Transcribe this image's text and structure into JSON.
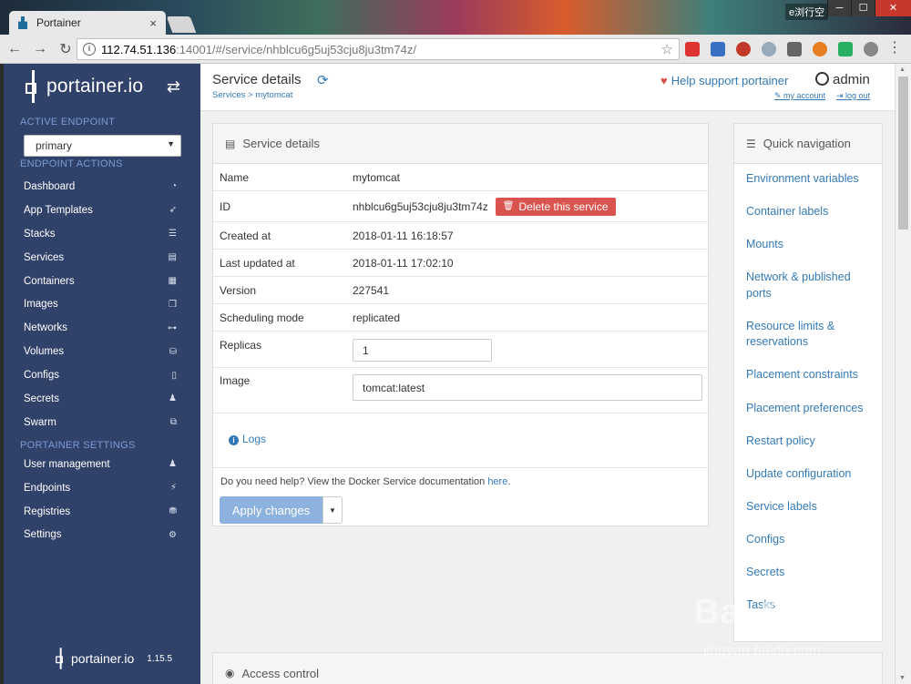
{
  "browser": {
    "tab_title": "Portainer",
    "tab_close": "×",
    "window_badge": "e浏行空",
    "url_host": "112.74.51.136",
    "url_path": ":14001/#/service/nhblcu6g5uj53cju8ju3tm74z/",
    "window_buttons": [
      "─",
      "☐",
      "✕"
    ]
  },
  "sidebar": {
    "logo_text": "portainer.io",
    "active_endpoint_heading": "ACTIVE ENDPOINT",
    "endpoint_value": "primary",
    "endpoint_actions_heading": "ENDPOINT ACTIONS",
    "endpoint_items": [
      {
        "label": "Dashboard",
        "icon": "dashboard-icon",
        "glyph": "◔"
      },
      {
        "label": "App Templates",
        "icon": "rocket-icon",
        "glyph": "➶"
      },
      {
        "label": "Stacks",
        "icon": "list-icon",
        "glyph": "☰"
      },
      {
        "label": "Services",
        "icon": "services-icon",
        "glyph": "▤"
      },
      {
        "label": "Containers",
        "icon": "containers-icon",
        "glyph": "▦"
      },
      {
        "label": "Images",
        "icon": "images-icon",
        "glyph": "❐"
      },
      {
        "label": "Networks",
        "icon": "sitemap-icon",
        "glyph": "⊶"
      },
      {
        "label": "Volumes",
        "icon": "cubes-icon",
        "glyph": "⛁"
      },
      {
        "label": "Configs",
        "icon": "file-code-icon",
        "glyph": "▯"
      },
      {
        "label": "Secrets",
        "icon": "user-secret-icon",
        "glyph": "♟"
      },
      {
        "label": "Swarm",
        "icon": "object-group-icon",
        "glyph": "⧉"
      }
    ],
    "portainer_settings_heading": "PORTAINER SETTINGS",
    "settings_items": [
      {
        "label": "User management",
        "icon": "users-icon",
        "glyph": "♟"
      },
      {
        "label": "Endpoints",
        "icon": "plug-icon",
        "glyph": "⚡"
      },
      {
        "label": "Registries",
        "icon": "database-icon",
        "glyph": "⛃"
      },
      {
        "label": "Settings",
        "icon": "cogs-icon",
        "glyph": "⚙"
      }
    ],
    "footer_logo": "portainer.io",
    "version": "1.15.5"
  },
  "header": {
    "title": "Service details",
    "breadcrumb": "Services > mytomcat",
    "help_support": "Help support portainer",
    "username": "admin",
    "my_account": "my account",
    "log_out": "log out"
  },
  "details": {
    "panel_title": "Service details",
    "rows": [
      {
        "key": "Name",
        "value": "mytomcat"
      },
      {
        "key": "ID",
        "value": "nhblcu6g5uj53cju8ju3tm74z"
      },
      {
        "key": "Created at",
        "value": "2018-01-11 16:18:57"
      },
      {
        "key": "Last updated at",
        "value": "2018-01-11 17:02:10"
      },
      {
        "key": "Version",
        "value": "227541"
      },
      {
        "key": "Scheduling mode",
        "value": "replicated"
      },
      {
        "key": "Replicas",
        "value": "1"
      },
      {
        "key": "Image",
        "value": "tomcat:latest"
      }
    ],
    "delete_button": "Delete this service",
    "logs_link": "Logs",
    "help_text": "Do you need help? View the Docker Service documentation",
    "help_link": "here",
    "help_tail": ".",
    "apply_button": "Apply changes"
  },
  "quick_nav": {
    "title": "Quick navigation",
    "items": [
      "Environment variables",
      "Container labels",
      "Mounts",
      "Network & published ports",
      "Resource limits & reservations",
      "Placement constraints",
      "Placement preferences",
      "Restart policy",
      "Update configuration",
      "Service labels",
      "Configs",
      "Secrets",
      "Tasks"
    ]
  },
  "access_control": {
    "title": "Access control"
  },
  "watermark": {
    "main": "Bai 经验",
    "sub": "jingyan.baidu.com"
  },
  "colors": {
    "sidebar_bg": "#30426a",
    "link": "#337ab7",
    "danger": "#d9534f",
    "apply_disabled": "#8db2dd"
  }
}
